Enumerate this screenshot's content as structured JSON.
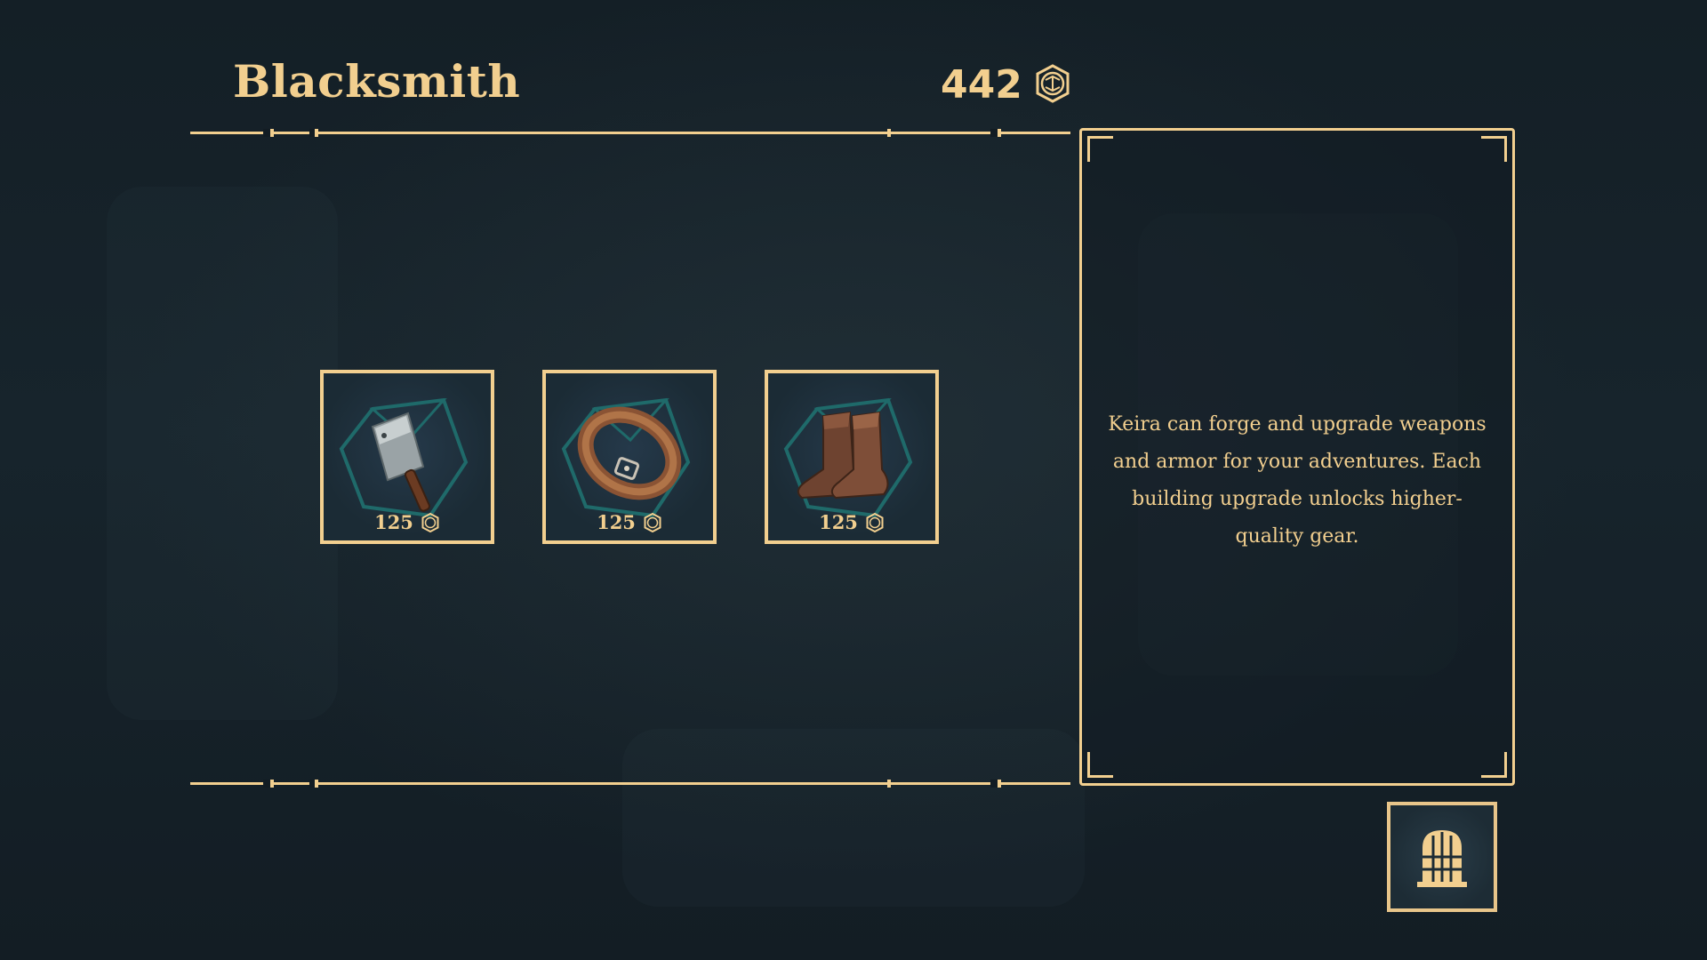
{
  "header": {
    "title": "Blacksmith",
    "currency_amount": "442",
    "currency_icon": "coin-emblem-icon"
  },
  "shop": {
    "items": [
      {
        "name": "cleaver",
        "icon": "cleaver-icon",
        "price": "125",
        "price_icon": "coin-emblem-icon"
      },
      {
        "name": "belt",
        "icon": "belt-icon",
        "price": "125",
        "price_icon": "coin-emblem-icon"
      },
      {
        "name": "boots",
        "icon": "boots-icon",
        "price": "125",
        "price_icon": "coin-emblem-icon"
      }
    ]
  },
  "info_panel": {
    "description": "Keira can forge and upgrade weapons and armor for your adventures. Each building upgrade unlocks higher-quality gear."
  },
  "exit_button": {
    "icon": "door-icon"
  },
  "colors": {
    "accent_gold": "#f2cf8f",
    "background": "#121c23",
    "slot_bg": "#1b2b35",
    "slot_gem_outline": "#1f6a6a"
  }
}
